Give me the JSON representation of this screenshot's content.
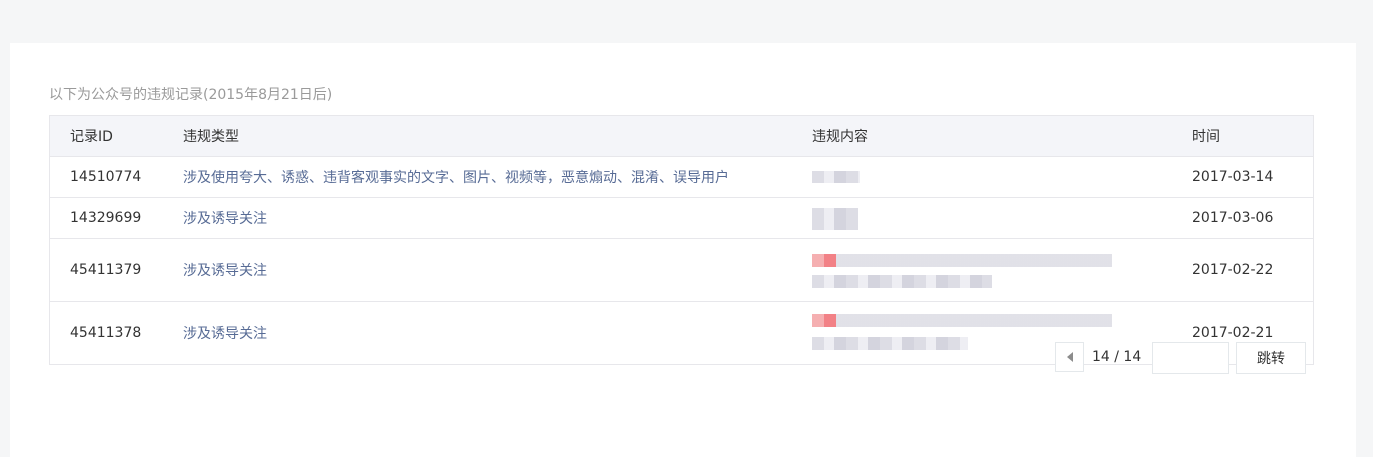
{
  "notice": "以下为公众号的违规记录(2015年8月21日后)",
  "table": {
    "headers": [
      "记录ID",
      "违规类型",
      "违规内容",
      "时间"
    ],
    "rows": [
      {
        "id": "14510774",
        "type": "涉及使用夸大、诱惑、违背客观事实的文字、图片、视频等，恶意煽动、混淆、误导用户",
        "time": "2017-03-14"
      },
      {
        "id": "14329699",
        "type": "涉及诱导关注",
        "time": "2017-03-06"
      },
      {
        "id": "45411379",
        "type": "涉及诱导关注",
        "time": "2017-02-22"
      },
      {
        "id": "45411378",
        "type": "涉及诱导关注",
        "time": "2017-02-21"
      }
    ]
  },
  "pagination": {
    "page_info": "14 / 14",
    "jump_input_value": "",
    "jump_label": "跳转"
  },
  "icons": {
    "prev": "triangle-left-icon"
  }
}
